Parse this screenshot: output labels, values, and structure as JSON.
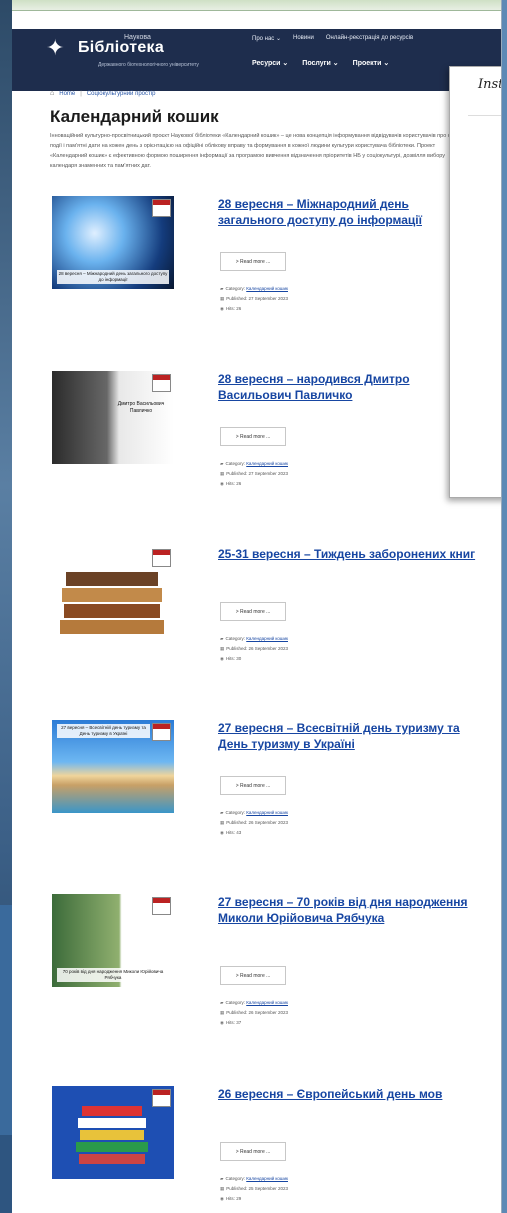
{
  "site": {
    "logo_title": "Бібліотека",
    "logo_super": "Наукова",
    "logo_sub": "Державного біотехнологічного університету",
    "nav_top": [
      "Про нас ⌄",
      "Новини",
      "Онлайн-реєстрація до ресурсів"
    ],
    "nav_main": [
      "Ресурси ⌄",
      "Послуги ⌄",
      "Проекти ⌄"
    ]
  },
  "breadcrumb": {
    "home": "Home",
    "current": "Соціокультурний простір"
  },
  "page_title": "Календарний кошик",
  "intro": "Інноваційний культурно-просвітницький проєкт Наукової бібліотеки «Календарний кошик» – це нова концепція інформування відвідувачів користувачів про свята, події і пам'ятні дати на кожен день з орієнтацією на офіційні облікову вправу та формування в кожної людини культури користувача бібліотеки. Проект «Календарний кошик» є ефективною формою поширення інформації за програмою вивчення відзначення пріоритетів НБ у соціокультурі, дозвілля вибору календаря знаменних та пам'ятних дат.",
  "articles": [
    {
      "title": "28 вересня – Міжнародний день загального доступу до інформації",
      "thumb_caption": "28 вересня – Міжнародний день загального доступу до інформації",
      "readmore": "> Read more ...",
      "category_label": "Category:",
      "category": "Календарний кошик",
      "published": "Published: 27 September 2023",
      "hits": "Hits: 26"
    },
    {
      "title": "28 вересня – народився Дмитро Васильович Павличко",
      "thumb_caption": "Дмитро Васильович Павличко",
      "readmore": "> Read more ...",
      "category_label": "Category:",
      "category": "Календарний кошик",
      "published": "Published: 27 September 2023",
      "hits": "Hits: 26"
    },
    {
      "title": "25-31 вересня – Тиждень заборонених книг",
      "thumb_caption": "",
      "readmore": "> Read more ...",
      "category_label": "Category:",
      "category": "Календарний кошик",
      "published": "Published: 26 September 2023",
      "hits": "Hits: 30"
    },
    {
      "title": "27 вересня – Всесвітній день туризму та День туризму в Україні",
      "thumb_caption": "27 вересня – Всесвітній день туризму та День туризму в Україні",
      "readmore": "> Read more ...",
      "category_label": "Category:",
      "category": "Календарний кошик",
      "published": "Published: 26 September 2023",
      "hits": "Hits: 43"
    },
    {
      "title": "27 вересня – 70 років від дня народження Миколи Юрійовича Рябчука",
      "thumb_caption": "70 років від дня народження Миколи Юрійовича Рябчука",
      "readmore": "> Read more ...",
      "category_label": "Category:",
      "category": "Календарний кошик",
      "published": "Published: 26 September 2023",
      "hits": "Hits: 37"
    },
    {
      "title": "26 вересня – Європейський день мов",
      "thumb_caption": "",
      "readmore": "> Read more ...",
      "category_label": "Category:",
      "category": "Календарний кошик",
      "published": "Published: 25 September 2023",
      "hits": "Hits: 29"
    }
  ],
  "popup": {
    "title": "Insta"
  },
  "colors": {
    "header_bg": "#1e2d4d",
    "link": "#1746a2",
    "desktop": "#7fa3c4"
  }
}
